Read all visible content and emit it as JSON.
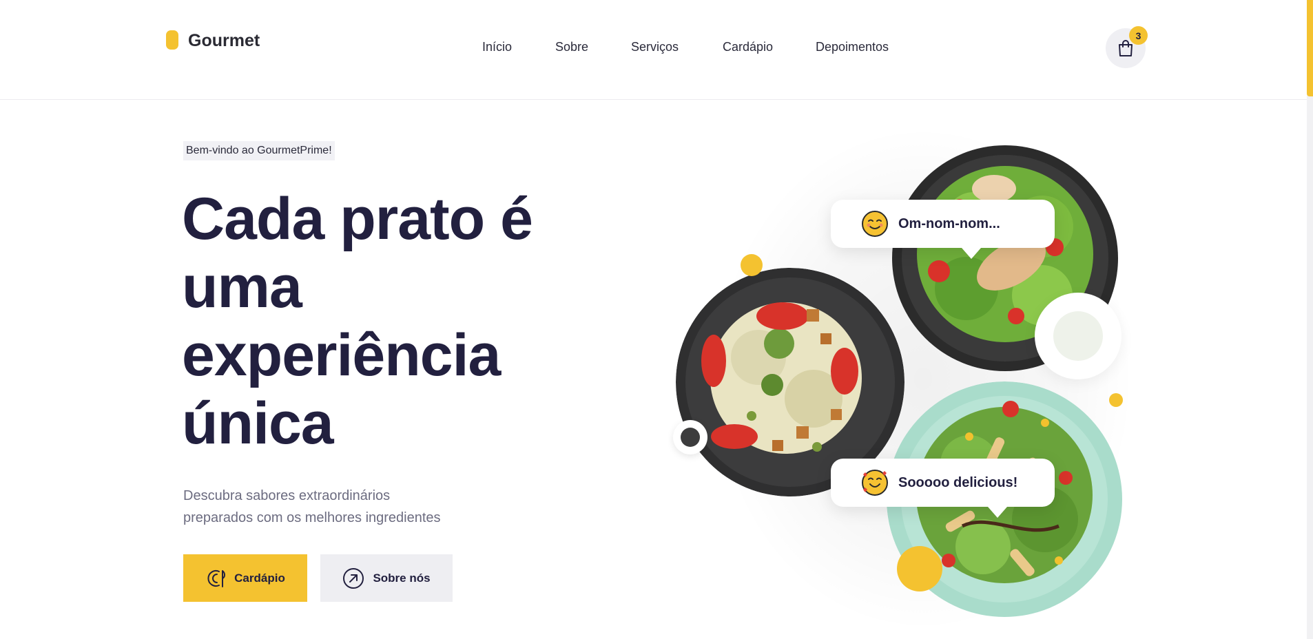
{
  "brand": {
    "name": "Gourmet"
  },
  "nav": {
    "items": [
      {
        "label": "Início"
      },
      {
        "label": "Sobre"
      },
      {
        "label": "Serviços"
      },
      {
        "label": "Cardápio"
      },
      {
        "label": "Depoimentos"
      }
    ]
  },
  "cart": {
    "count": "3",
    "icon": "shopping-bag-icon"
  },
  "hero": {
    "badge": "Bem-vindo ao GourmetPrime!",
    "title_lines": [
      "Cada prato é",
      "uma",
      "experiência",
      "única"
    ],
    "subtitle_lines": [
      "Descubra sabores extraordinários",
      "preparados com os melhores ingredientes"
    ],
    "primary_button": {
      "label": "Cardápio",
      "icon": "utensils-plate-icon"
    },
    "secondary_button": {
      "label": "Sobre nós",
      "icon": "arrow-up-right-circle-icon"
    }
  },
  "bubbles": [
    {
      "text": "Om-nom-nom...",
      "icon": "yum-face-emoji"
    },
    {
      "text": "Sooooo delicious!",
      "icon": "hearts-face-emoji"
    }
  ],
  "colors": {
    "accent": "#f4c230",
    "text": "#22203f",
    "muted": "#6c6c80",
    "mint": "#a9dccb"
  }
}
